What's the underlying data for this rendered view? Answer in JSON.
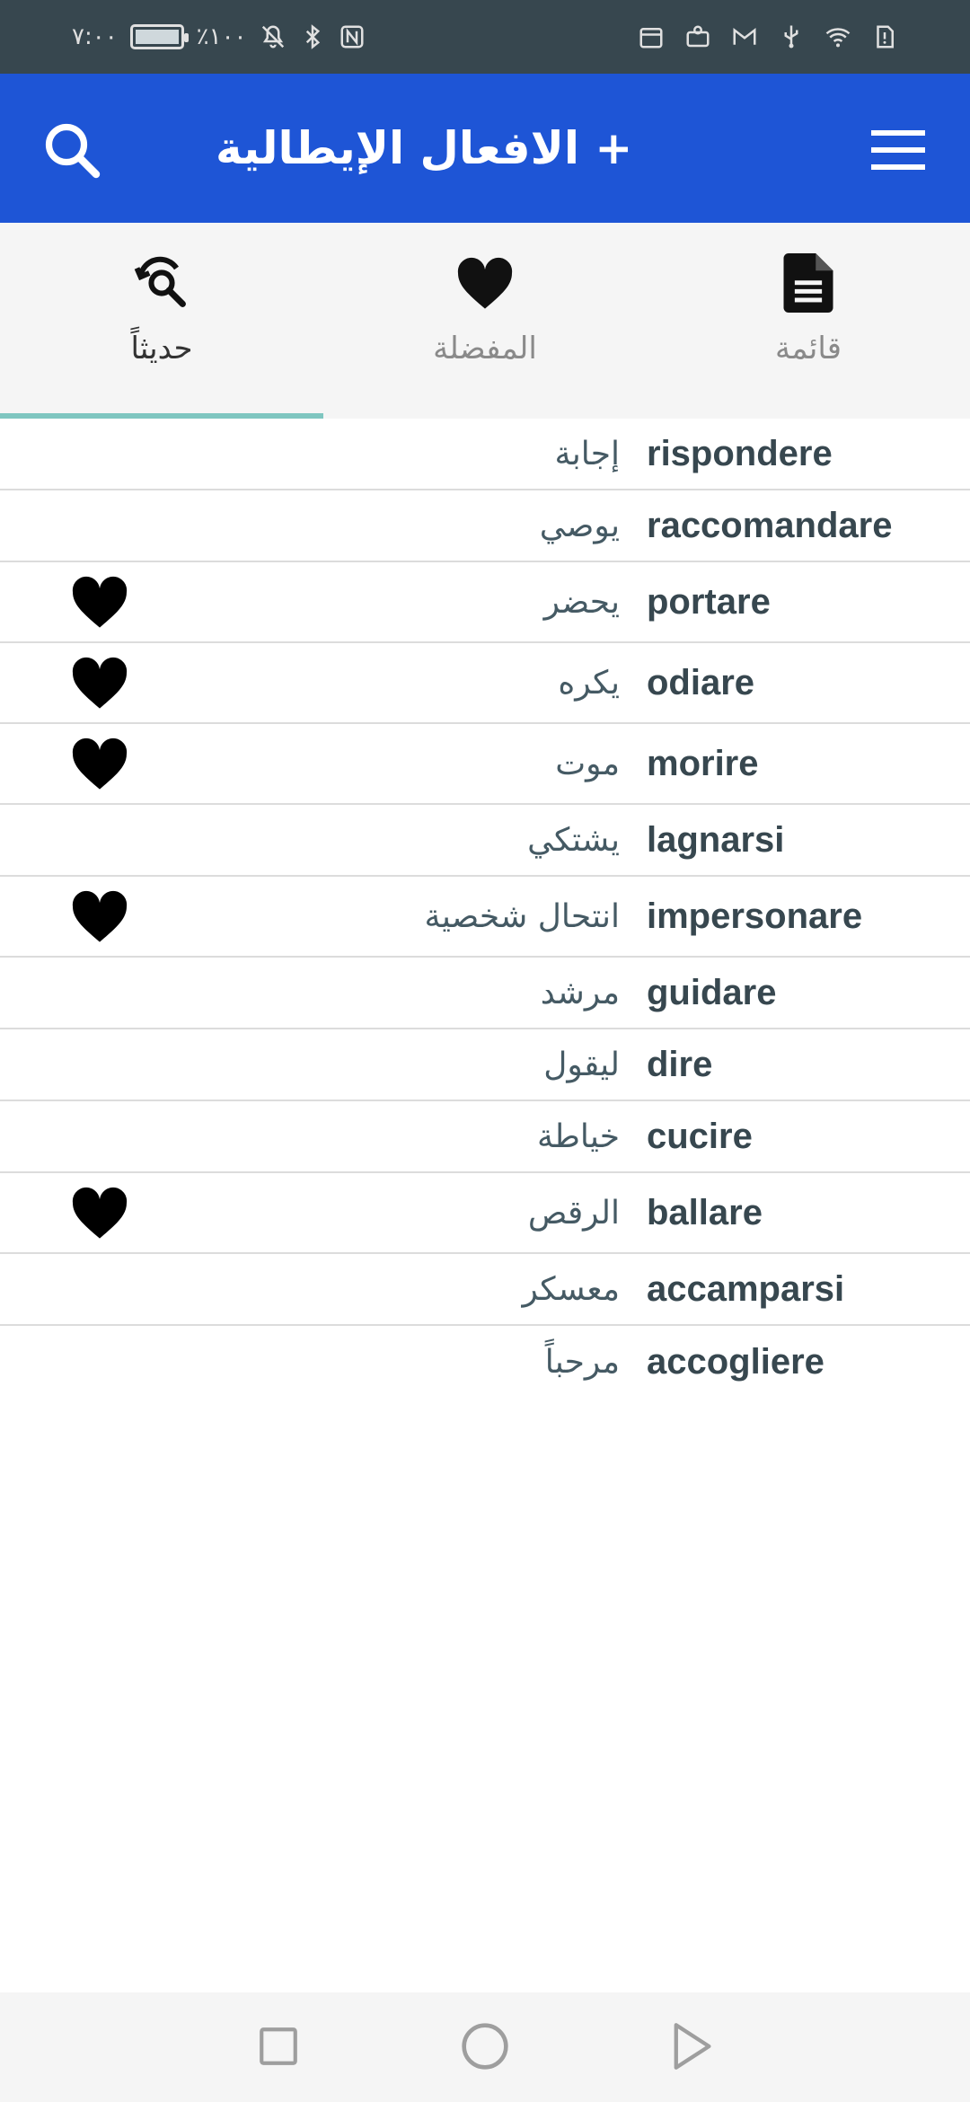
{
  "status_bar": {
    "time": "٧:٠٠",
    "battery_text": "٪١٠٠",
    "left_icons": [
      "battery-icon",
      "mute-icon",
      "bluetooth-icon",
      "nfc-icon"
    ],
    "right_icons": [
      "calendar-icon",
      "app-icon",
      "gmail-icon",
      "usb-icon",
      "wifi-icon",
      "alert-icon"
    ]
  },
  "app_bar": {
    "title": "+ الافعال الإيطالية",
    "background": "#1e55d6"
  },
  "tabs": [
    {
      "label": "قائمة",
      "icon": "document-icon",
      "active": false
    },
    {
      "label": "المفضلة",
      "icon": "heart-icon",
      "active": false
    },
    {
      "label": "حديثاً",
      "icon": "history-search-icon",
      "active": true
    }
  ],
  "verbs": [
    {
      "verb": "rispondere",
      "meaning": "إجابة",
      "favorite": false
    },
    {
      "verb": "raccomandare",
      "meaning": "يوصي",
      "favorite": false
    },
    {
      "verb": "portare",
      "meaning": "يحضر",
      "favorite": true
    },
    {
      "verb": "odiare",
      "meaning": "يكره",
      "favorite": true
    },
    {
      "verb": "morire",
      "meaning": "موت",
      "favorite": true
    },
    {
      "verb": "lagnarsi",
      "meaning": "يشتكي",
      "favorite": false
    },
    {
      "verb": "impersonare",
      "meaning": "انتحال شخصية",
      "favorite": true
    },
    {
      "verb": "guidare",
      "meaning": "مرشد",
      "favorite": false
    },
    {
      "verb": "dire",
      "meaning": "ليقول",
      "favorite": false
    },
    {
      "verb": "cucire",
      "meaning": "خياطة",
      "favorite": false
    },
    {
      "verb": "ballare",
      "meaning": "الرقص",
      "favorite": true
    },
    {
      "verb": "accamparsi",
      "meaning": "معسكر",
      "favorite": false
    },
    {
      "verb": "accogliere",
      "meaning": "مرحباً",
      "favorite": false
    }
  ],
  "nav_bar": {
    "buttons": [
      "recents-icon",
      "home-icon",
      "back-icon"
    ]
  },
  "colors": {
    "accent_tab_indicator": "#7fc6c0",
    "status_bar": "#37474f",
    "verb_text": "#37474f"
  }
}
